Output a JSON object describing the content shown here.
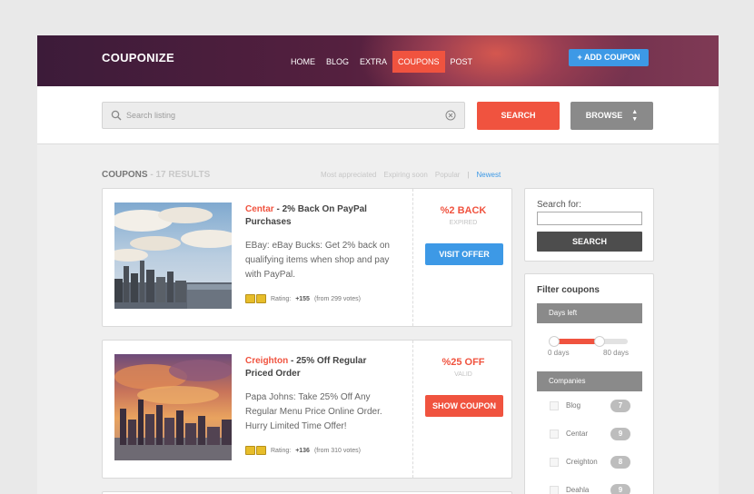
{
  "header": {
    "logo": "COUPONIZE",
    "nav": [
      "HOME",
      "BLOG",
      "EXTRA",
      "COUPONS",
      "POST"
    ],
    "active_nav": "COUPONS",
    "add_coupon": "+ ADD COUPON"
  },
  "search": {
    "placeholder": "Search listing",
    "search_button": "SEARCH",
    "browse_button": "BROWSE"
  },
  "results": {
    "label": "COUPONS",
    "count": " - 17 RESULTS",
    "sorts": [
      "Most appreciated",
      "Expiring soon",
      "Popular"
    ],
    "active_sort": "Newest"
  },
  "coupons": [
    {
      "brand": "Centar",
      "title": " - 2% Back On PayPal Purchases",
      "description": "EBay: eBay Bucks: Get 2% back on qualifying items when shop and pay with PayPal.",
      "rating_label": "Rating:",
      "rating_value": "+155",
      "votes": "(from 299 votes)",
      "offer": "%2 BACK",
      "status": "EXPIRED",
      "button": "VISIT OFFER",
      "button_color": "#3d99e6"
    },
    {
      "brand": "Creighton",
      "title": " - 25% Off Regular Priced Order",
      "description": "Papa Johns: Take 25% Off Any Regular Menu Price Online Order. Hurry Limited Time Offer!",
      "rating_label": "Rating:",
      "rating_value": "+136",
      "votes": "(from 310 votes)",
      "offer": "%25 OFF",
      "status": "VALID",
      "button": "SHOW COUPON",
      "button_color": "#f0533f"
    }
  ],
  "sidebar": {
    "search_for_label": "Search for:",
    "search_button": "SEARCH",
    "filter_title": "Filter coupons",
    "days_left_label": "Days left",
    "slider_min": "0 days",
    "slider_max": "80 days",
    "slider_value_fraction": 0.62,
    "companies_label": "Companies",
    "companies": [
      {
        "name": "Blog",
        "count": "7"
      },
      {
        "name": "Centar",
        "count": "9"
      },
      {
        "name": "Creighton",
        "count": "8"
      },
      {
        "name": "Deahla",
        "count": "9"
      }
    ]
  },
  "colors": {
    "accent": "#f0533f",
    "blue": "#3d99e6",
    "gray_button": "#8a8a8a",
    "dark_button": "#4d4d4d"
  }
}
